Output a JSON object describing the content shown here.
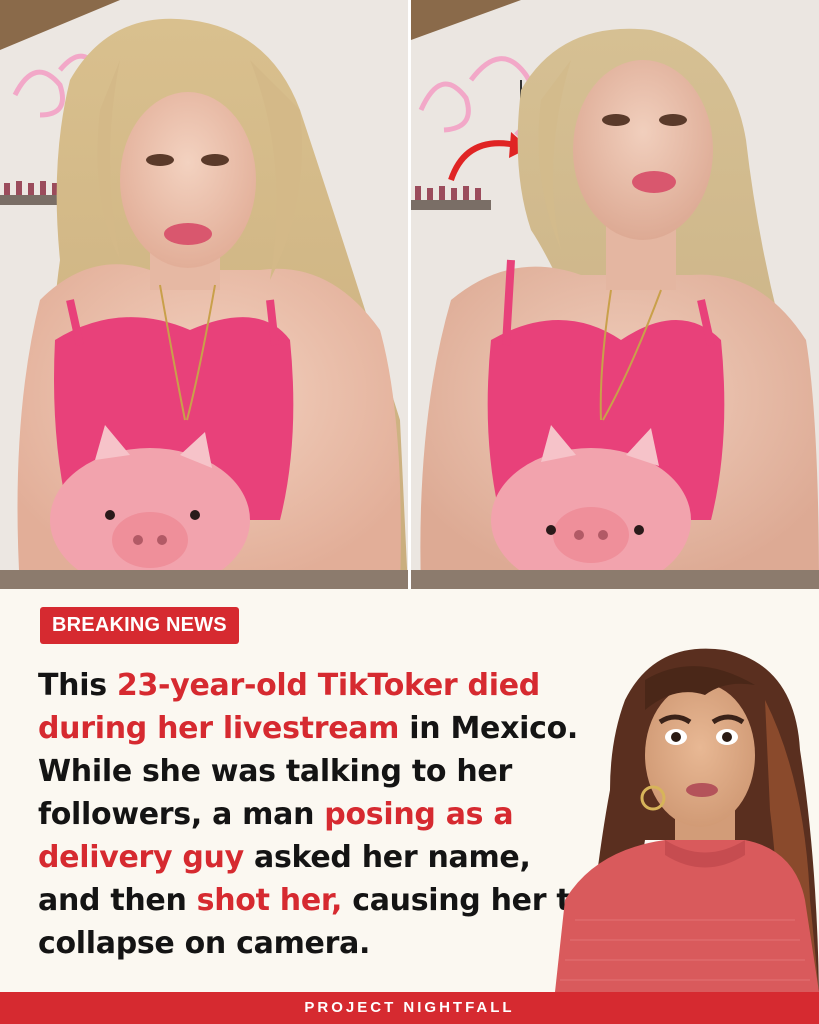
{
  "badge": {
    "label": "BREAKING NEWS"
  },
  "headline": {
    "segments": [
      {
        "text": "This ",
        "highlight": false
      },
      {
        "text": "23-year-old TikToker died during her livestream",
        "highlight": true
      },
      {
        "text": " in Mexico. While she was talking to her followers, a man ",
        "highlight": false
      },
      {
        "text": "posing as a delivery guy",
        "highlight": true
      },
      {
        "text": " asked her name, and then ",
        "highlight": false
      },
      {
        "text": "shot her,",
        "highlight": true
      },
      {
        "text": " causing her to collapse on camera.",
        "highlight": false
      }
    ]
  },
  "footer": {
    "brand": "PROJECT NIGHTFALL"
  },
  "colors": {
    "accent": "#d62a30",
    "background": "#fbf8f1",
    "text": "#141414",
    "top_pink": "#e8417a",
    "plush_pink": "#f2a3ad",
    "reactor_sweater": "#d95a5c"
  },
  "icons": {
    "pointer_arrow": "red-curved-arrow-icon"
  }
}
